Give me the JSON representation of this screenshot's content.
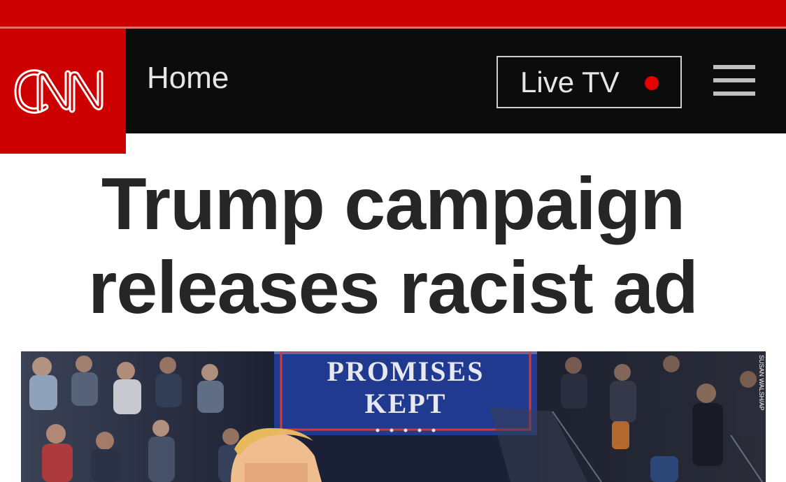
{
  "header": {
    "logo_text": "CNN",
    "nav_home_label": "Home",
    "live_tv_label": "Live TV",
    "menu_icon": "hamburger-menu-icon",
    "colors": {
      "brand_red": "#cc0000",
      "nav_bg": "#0c0c0c",
      "live_dot": "#e60000"
    }
  },
  "article": {
    "headline": "Trump campaign releases racist ad",
    "photo": {
      "sign_line_1": "PROMISES",
      "sign_line_2": "KEPT",
      "credit": "SUSAN WALSH/AP"
    }
  }
}
